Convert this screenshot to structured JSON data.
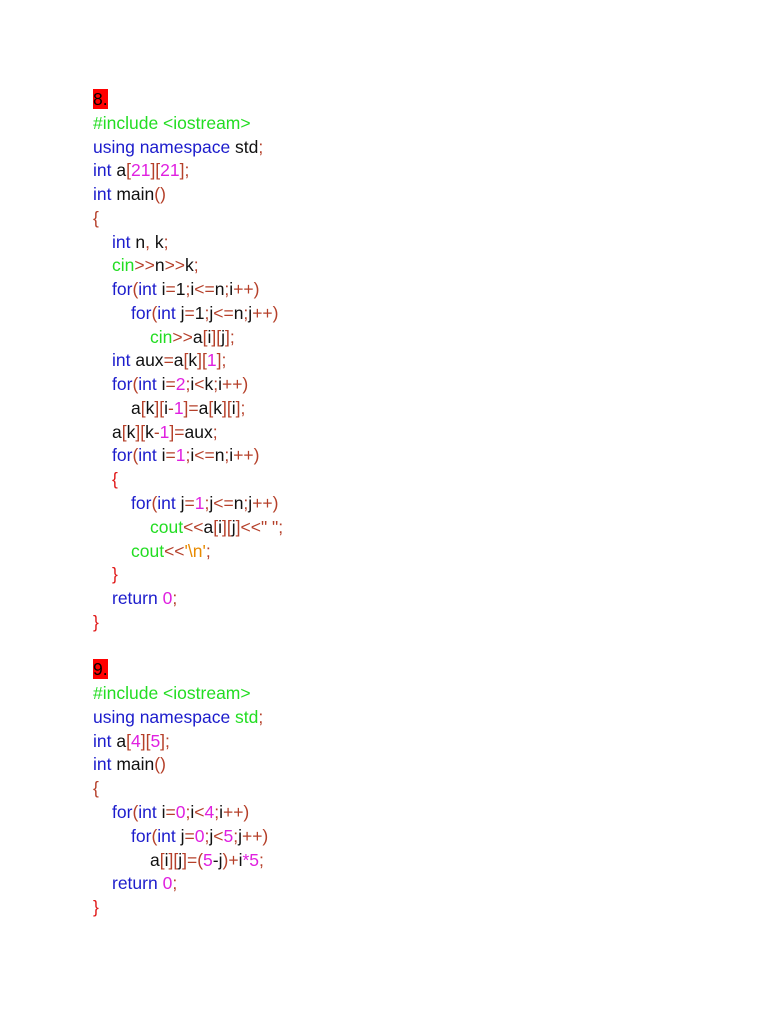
{
  "sections": [
    {
      "heading": "8.",
      "lines": [
        {
          "indent": 0,
          "tokens": [
            [
              "#include <iostream>",
              "g"
            ]
          ]
        },
        {
          "indent": 0,
          "tokens": [
            [
              "using namespace",
              "k"
            ],
            [
              " std",
              "t"
            ],
            [
              ";",
              "p"
            ]
          ]
        },
        {
          "indent": 0,
          "tokens": [
            [
              "int",
              "k"
            ],
            [
              " a",
              "t"
            ],
            [
              "[",
              "p"
            ],
            [
              "21",
              "n"
            ],
            [
              "][",
              "p"
            ],
            [
              "21",
              "n"
            ],
            [
              "];",
              "p"
            ]
          ]
        },
        {
          "indent": 0,
          "tokens": [
            [
              "int",
              "k"
            ],
            [
              " main",
              "t"
            ],
            [
              "()",
              "p"
            ]
          ]
        },
        {
          "indent": 0,
          "tokens": [
            [
              "{",
              "p"
            ]
          ]
        },
        {
          "indent": 1,
          "tokens": [
            [
              "int",
              "k"
            ],
            [
              " n",
              "t"
            ],
            [
              ",",
              "p"
            ],
            [
              " k",
              "t"
            ],
            [
              ";",
              "p"
            ]
          ]
        },
        {
          "indent": 1,
          "tokens": [
            [
              "cin",
              "g"
            ],
            [
              ">>",
              "p"
            ],
            [
              "n",
              "t"
            ],
            [
              ">>",
              "p"
            ],
            [
              "k",
              "t"
            ],
            [
              ";",
              "p"
            ]
          ]
        },
        {
          "indent": 1,
          "tokens": [
            [
              "for",
              "k"
            ],
            [
              "(",
              "p"
            ],
            [
              "int",
              "k"
            ],
            [
              " i",
              "t"
            ],
            [
              "=",
              "p"
            ],
            [
              "1",
              "t"
            ],
            [
              ";",
              "p"
            ],
            [
              "i",
              "t"
            ],
            [
              "<=",
              "p"
            ],
            [
              "n",
              "t"
            ],
            [
              ";",
              "p"
            ],
            [
              "i",
              "t"
            ],
            [
              "++)",
              "p"
            ]
          ]
        },
        {
          "indent": 2,
          "tokens": [
            [
              "for",
              "k"
            ],
            [
              "(",
              "p"
            ],
            [
              "int",
              "k"
            ],
            [
              " j",
              "t"
            ],
            [
              "=",
              "p"
            ],
            [
              "1",
              "t"
            ],
            [
              ";",
              "p"
            ],
            [
              "j",
              "t"
            ],
            [
              "<=",
              "p"
            ],
            [
              "n",
              "t"
            ],
            [
              ";",
              "p"
            ],
            [
              "j",
              "t"
            ],
            [
              "++)",
              "p"
            ]
          ]
        },
        {
          "indent": 3,
          "tokens": [
            [
              "cin",
              "g"
            ],
            [
              ">>",
              "p"
            ],
            [
              "a",
              "t"
            ],
            [
              "[",
              "p"
            ],
            [
              "i",
              "t"
            ],
            [
              "][",
              "p"
            ],
            [
              "j",
              "t"
            ],
            [
              "];",
              "p"
            ]
          ]
        },
        {
          "indent": 1,
          "tokens": [
            [
              "int",
              "k"
            ],
            [
              " aux",
              "t"
            ],
            [
              "=",
              "p"
            ],
            [
              "a",
              "t"
            ],
            [
              "[",
              "p"
            ],
            [
              "k",
              "t"
            ],
            [
              "][",
              "p"
            ],
            [
              "1",
              "n"
            ],
            [
              "];",
              "p"
            ]
          ]
        },
        {
          "indent": 1,
          "tokens": [
            [
              "for",
              "k"
            ],
            [
              "(",
              "p"
            ],
            [
              "int",
              "k"
            ],
            [
              " i",
              "t"
            ],
            [
              "=",
              "p"
            ],
            [
              "2",
              "n"
            ],
            [
              ";",
              "p"
            ],
            [
              "i",
              "t"
            ],
            [
              "<",
              "p"
            ],
            [
              "k",
              "t"
            ],
            [
              ";",
              "p"
            ],
            [
              "i",
              "t"
            ],
            [
              "++)",
              "p"
            ]
          ]
        },
        {
          "indent": 2,
          "tokens": [
            [
              "a",
              "t"
            ],
            [
              "[",
              "p"
            ],
            [
              "k",
              "t"
            ],
            [
              "][",
              "p"
            ],
            [
              "i",
              "t"
            ],
            [
              "-",
              "p"
            ],
            [
              "1",
              "n"
            ],
            [
              "]=",
              "p"
            ],
            [
              "a",
              "t"
            ],
            [
              "[",
              "p"
            ],
            [
              "k",
              "t"
            ],
            [
              "][",
              "p"
            ],
            [
              "i",
              "t"
            ],
            [
              "];",
              "p"
            ]
          ]
        },
        {
          "indent": 1,
          "tokens": [
            [
              "a",
              "t"
            ],
            [
              "[",
              "p"
            ],
            [
              "k",
              "t"
            ],
            [
              "][",
              "p"
            ],
            [
              "k",
              "t"
            ],
            [
              "-",
              "p"
            ],
            [
              "1",
              "n"
            ],
            [
              "]=",
              "p"
            ],
            [
              "aux",
              "t"
            ],
            [
              ";",
              "p"
            ]
          ]
        },
        {
          "indent": 1,
          "tokens": [
            [
              "for",
              "k"
            ],
            [
              "(",
              "p"
            ],
            [
              "int",
              "k"
            ],
            [
              " i",
              "t"
            ],
            [
              "=",
              "p"
            ],
            [
              "1",
              "n"
            ],
            [
              ";",
              "p"
            ],
            [
              "i",
              "t"
            ],
            [
              "<=",
              "p"
            ],
            [
              "n",
              "t"
            ],
            [
              ";",
              "p"
            ],
            [
              "i",
              "t"
            ],
            [
              "++)",
              "p"
            ]
          ]
        },
        {
          "indent": 1,
          "tokens": [
            [
              "{",
              "b"
            ]
          ]
        },
        {
          "indent": 2,
          "tokens": [
            [
              "for",
              "k"
            ],
            [
              "(",
              "p"
            ],
            [
              "int",
              "k"
            ],
            [
              " j",
              "t"
            ],
            [
              "=",
              "p"
            ],
            [
              "1",
              "n"
            ],
            [
              ";",
              "p"
            ],
            [
              "j",
              "t"
            ],
            [
              "<=",
              "p"
            ],
            [
              "n",
              "t"
            ],
            [
              ";",
              "p"
            ],
            [
              "j",
              "t"
            ],
            [
              "++)",
              "p"
            ]
          ]
        },
        {
          "indent": 3,
          "tokens": [
            [
              "cout",
              "g"
            ],
            [
              "<<",
              "p"
            ],
            [
              "a",
              "t"
            ],
            [
              "[",
              "p"
            ],
            [
              "i",
              "t"
            ],
            [
              "][",
              "p"
            ],
            [
              "j",
              "t"
            ],
            [
              "]<<\" \";",
              "p"
            ]
          ]
        },
        {
          "indent": 2,
          "tokens": [
            [
              "cout",
              "g"
            ],
            [
              "<<",
              "p"
            ],
            [
              "'\\n'",
              "s"
            ],
            [
              ";",
              "p"
            ]
          ]
        },
        {
          "indent": 1,
          "tokens": [
            [
              "}",
              "b"
            ]
          ]
        },
        {
          "indent": 1,
          "tokens": [
            [
              "return",
              "k"
            ],
            [
              " 0",
              "n"
            ],
            [
              ";",
              "p"
            ]
          ]
        },
        {
          "indent": 0,
          "tokens": [
            [
              "}",
              "b"
            ]
          ]
        }
      ]
    },
    {
      "heading": "9.",
      "lines": [
        {
          "indent": 0,
          "tokens": [
            [
              "#include <iostream>",
              "g"
            ]
          ]
        },
        {
          "indent": 0,
          "tokens": [
            [
              "using namespace",
              "k"
            ],
            [
              " std",
              "g"
            ],
            [
              ";",
              "p"
            ]
          ]
        },
        {
          "indent": 0,
          "tokens": [
            [
              "int",
              "k"
            ],
            [
              " a",
              "t"
            ],
            [
              "[",
              "p"
            ],
            [
              "4",
              "n"
            ],
            [
              "][",
              "p"
            ],
            [
              "5",
              "n"
            ],
            [
              "];",
              "p"
            ]
          ]
        },
        {
          "indent": 0,
          "tokens": [
            [
              "int",
              "k"
            ],
            [
              " main",
              "t"
            ],
            [
              "()",
              "p"
            ]
          ]
        },
        {
          "indent": 0,
          "tokens": [
            [
              "{",
              "p"
            ]
          ]
        },
        {
          "indent": 1,
          "tokens": [
            [
              "for",
              "k"
            ],
            [
              "(",
              "p"
            ],
            [
              "int",
              "k"
            ],
            [
              " i",
              "t"
            ],
            [
              "=",
              "p"
            ],
            [
              "0",
              "n"
            ],
            [
              ";",
              "p"
            ],
            [
              "i",
              "t"
            ],
            [
              "<",
              "p"
            ],
            [
              "4",
              "n"
            ],
            [
              ";",
              "p"
            ],
            [
              "i",
              "t"
            ],
            [
              "++)",
              "p"
            ]
          ]
        },
        {
          "indent": 2,
          "tokens": [
            [
              "for",
              "k"
            ],
            [
              "(",
              "p"
            ],
            [
              "int",
              "k"
            ],
            [
              " j",
              "t"
            ],
            [
              "=",
              "p"
            ],
            [
              "0",
              "n"
            ],
            [
              ";",
              "p"
            ],
            [
              "j",
              "t"
            ],
            [
              "<",
              "p"
            ],
            [
              "5",
              "n"
            ],
            [
              ";",
              "p"
            ],
            [
              "j",
              "t"
            ],
            [
              "++)",
              "p"
            ]
          ]
        },
        {
          "indent": 3,
          "tokens": [
            [
              "a",
              "t"
            ],
            [
              "[",
              "p"
            ],
            [
              "i",
              "t"
            ],
            [
              "][",
              "p"
            ],
            [
              "j",
              "t"
            ],
            [
              "]=(",
              "p"
            ],
            [
              "5",
              "n"
            ],
            [
              "-j",
              "t"
            ],
            [
              ")+",
              "p"
            ],
            [
              "i",
              "t"
            ],
            [
              "*",
              "n"
            ],
            [
              "5",
              "n"
            ],
            [
              ";",
              "p"
            ]
          ]
        },
        {
          "indent": 1,
          "tokens": [
            [
              "return",
              "k"
            ],
            [
              " 0",
              "n"
            ],
            [
              ";",
              "p"
            ]
          ]
        },
        {
          "indent": 0,
          "tokens": [
            [
              "}",
              "b"
            ]
          ]
        }
      ]
    }
  ],
  "colors": {
    "keyword": "#1c1ccc",
    "green": "#22dd22",
    "punct": "#b5402a",
    "number": "#e020e0",
    "string": "#e88a00",
    "brace": "#e01818",
    "heading_bg": "#ff0000"
  }
}
